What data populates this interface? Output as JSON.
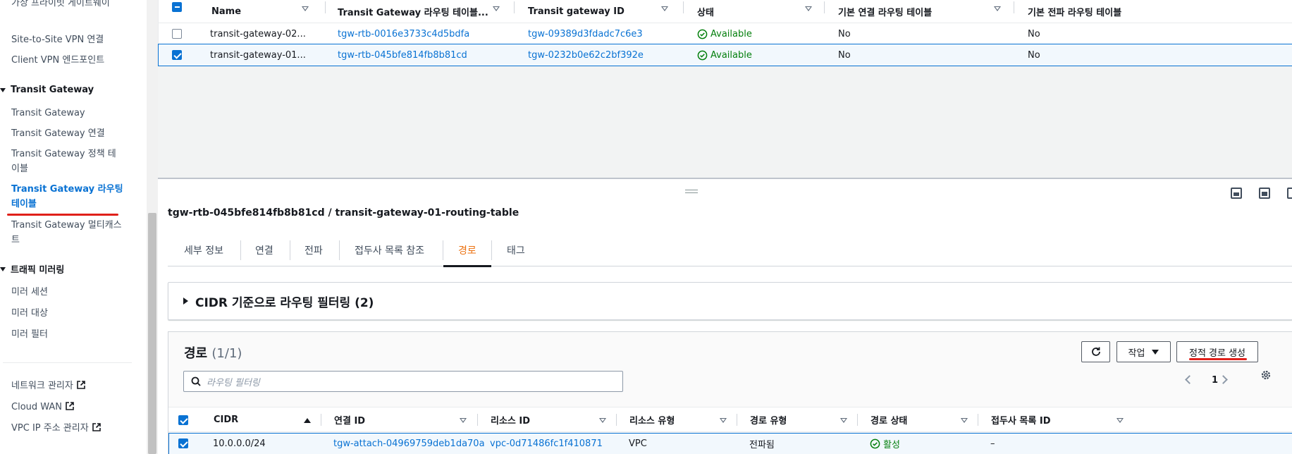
{
  "sidebar": {
    "items_top": [
      "가상 프라이빗 게이트웨이",
      "Site-to-Site VPN 연결",
      "Client VPN 엔드포인트"
    ],
    "section_tgw": "Transit Gateway",
    "tgw_items": [
      "Transit Gateway",
      "Transit Gateway 연결",
      "Transit Gateway 정책 테이블",
      "Transit Gateway 라우팅 테이블",
      "Transit Gateway 멀티캐스트"
    ],
    "section_mirror": "트래픽 미러링",
    "mirror_items": [
      "미러 세션",
      "미러 대상",
      "미러 필터"
    ],
    "ext_links": [
      "네트워크 관리자",
      "Cloud WAN",
      "VPC IP 주소 관리자"
    ]
  },
  "top_table": {
    "headers": [
      "Name",
      "Transit Gateway 라우팅 테이블...",
      "Transit gateway ID",
      "상태",
      "기본 연결 라우팅 테이블",
      "기본 전파 라우팅 테이블"
    ],
    "rows": [
      {
        "name": "transit-gateway-02...",
        "rtb": "tgw-rtb-0016e3733c4d5bdfa",
        "tgw": "tgw-09389d3fdadc7c6e3",
        "state": "Available",
        "assoc": "No",
        "prop": "No",
        "selected": false
      },
      {
        "name": "transit-gateway-01...",
        "rtb": "tgw-rtb-045bfe814fb8b81cd",
        "tgw": "tgw-0232b0e62c2bf392e",
        "state": "Available",
        "assoc": "No",
        "prop": "No",
        "selected": true
      }
    ]
  },
  "detail": {
    "title": "tgw-rtb-045bfe814fb8b81cd / transit-gateway-01-routing-table",
    "tabs": [
      "세부 정보",
      "연결",
      "전파",
      "접두사 목록 참조",
      "경로",
      "태그"
    ],
    "active_tab": "경로"
  },
  "filter_section": {
    "title": "CIDR 기준으로 라우팅 필터링 (2)"
  },
  "routes": {
    "title": "경로",
    "count": "(1/1)",
    "actions_label": "작업",
    "create_label": "정적 경로 생성",
    "search_placeholder": "라우팅 필터링",
    "page": "1",
    "headers": [
      "CIDR",
      "연결 ID",
      "리소스 ID",
      "리소스 유형",
      "경로 유형",
      "경로 상태",
      "접두사 목록 ID"
    ],
    "rows": [
      {
        "cidr": "10.0.0.0/24",
        "attach": "tgw-attach-04969759deb1da70a",
        "resource": "vpc-0d71486fc1f410871",
        "rtype": "VPC",
        "route_type": "전파됨",
        "state": "활성",
        "prefix": "–"
      }
    ]
  },
  "colors": {
    "link": "#0972d3",
    "success": "#037f0c",
    "active_tab": "#ec7211",
    "annotation": "#e0201a"
  }
}
